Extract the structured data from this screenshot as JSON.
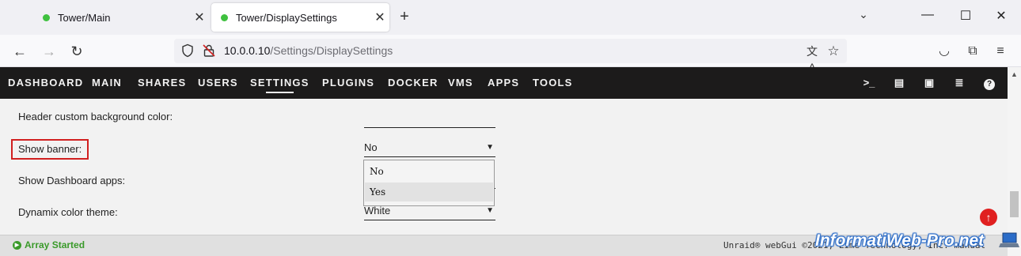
{
  "browser": {
    "tabs": [
      {
        "title": "Tower/Main",
        "active": false
      },
      {
        "title": "Tower/DisplaySettings",
        "active": true
      }
    ],
    "url": {
      "host": "10.0.0.10",
      "path": "/Settings/DisplaySettings"
    }
  },
  "menu": {
    "items": [
      "DASHBOARD",
      "MAIN",
      "SHARES",
      "USERS",
      "SETTINGS",
      "PLUGINS",
      "DOCKER",
      "VMS",
      "APPS",
      "TOOLS"
    ],
    "active": "SETTINGS"
  },
  "settings": {
    "header_bg_label": "Header custom background color:",
    "header_bg_value": "",
    "show_banner_label": "Show banner:",
    "show_banner_value": "No",
    "show_banner_options": [
      "No",
      "Yes"
    ],
    "dashboard_apps_label": "Show Dashboard apps:",
    "color_theme_label": "Dynamix color theme:",
    "color_theme_value": "White"
  },
  "footer": {
    "status": "Array Started",
    "copyright": "Unraid® webGui ©2021, Lime Technology, Inc. manual"
  },
  "watermark": "InformatiWeb-Pro.net",
  "colors": {
    "menu_bg": "#1c1b1b",
    "highlight": "#d12020",
    "status_green": "#3a9a2a",
    "scroll_top_red": "#e02020"
  }
}
